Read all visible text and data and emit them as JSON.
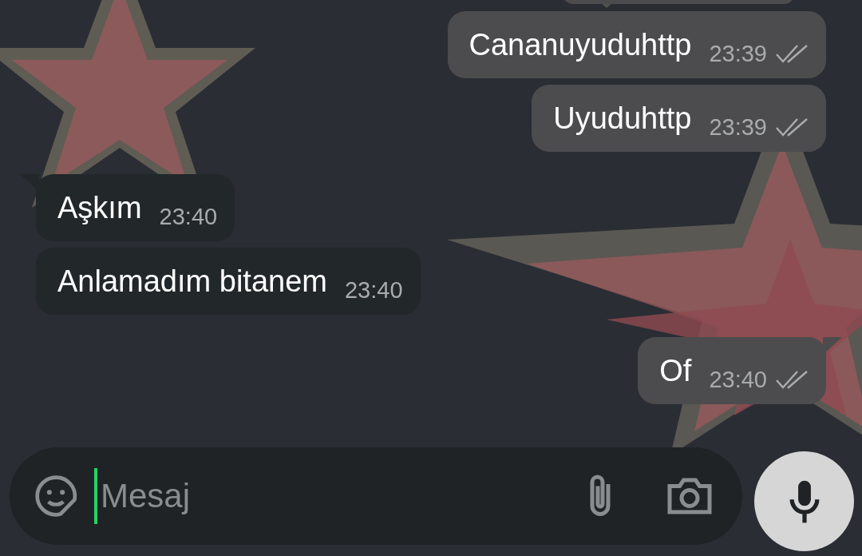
{
  "messages": [
    {
      "kind": "outgoing",
      "text": "Cananuyuduhttp",
      "time": "23:39",
      "read": false,
      "tail": false
    },
    {
      "kind": "outgoing",
      "text": "Uyuduhttp",
      "time": "23:39",
      "read": false,
      "tail": false
    },
    {
      "kind": "incoming",
      "text": "Aşkım",
      "time": "23:40",
      "tail": true
    },
    {
      "kind": "incoming",
      "text": "Anlamadım bitanem",
      "time": "23:40",
      "tail": false
    },
    {
      "kind": "outgoing",
      "text": "Of",
      "time": "23:40",
      "read": false,
      "tail": true
    }
  ],
  "composer": {
    "placeholder": "Mesaj"
  }
}
